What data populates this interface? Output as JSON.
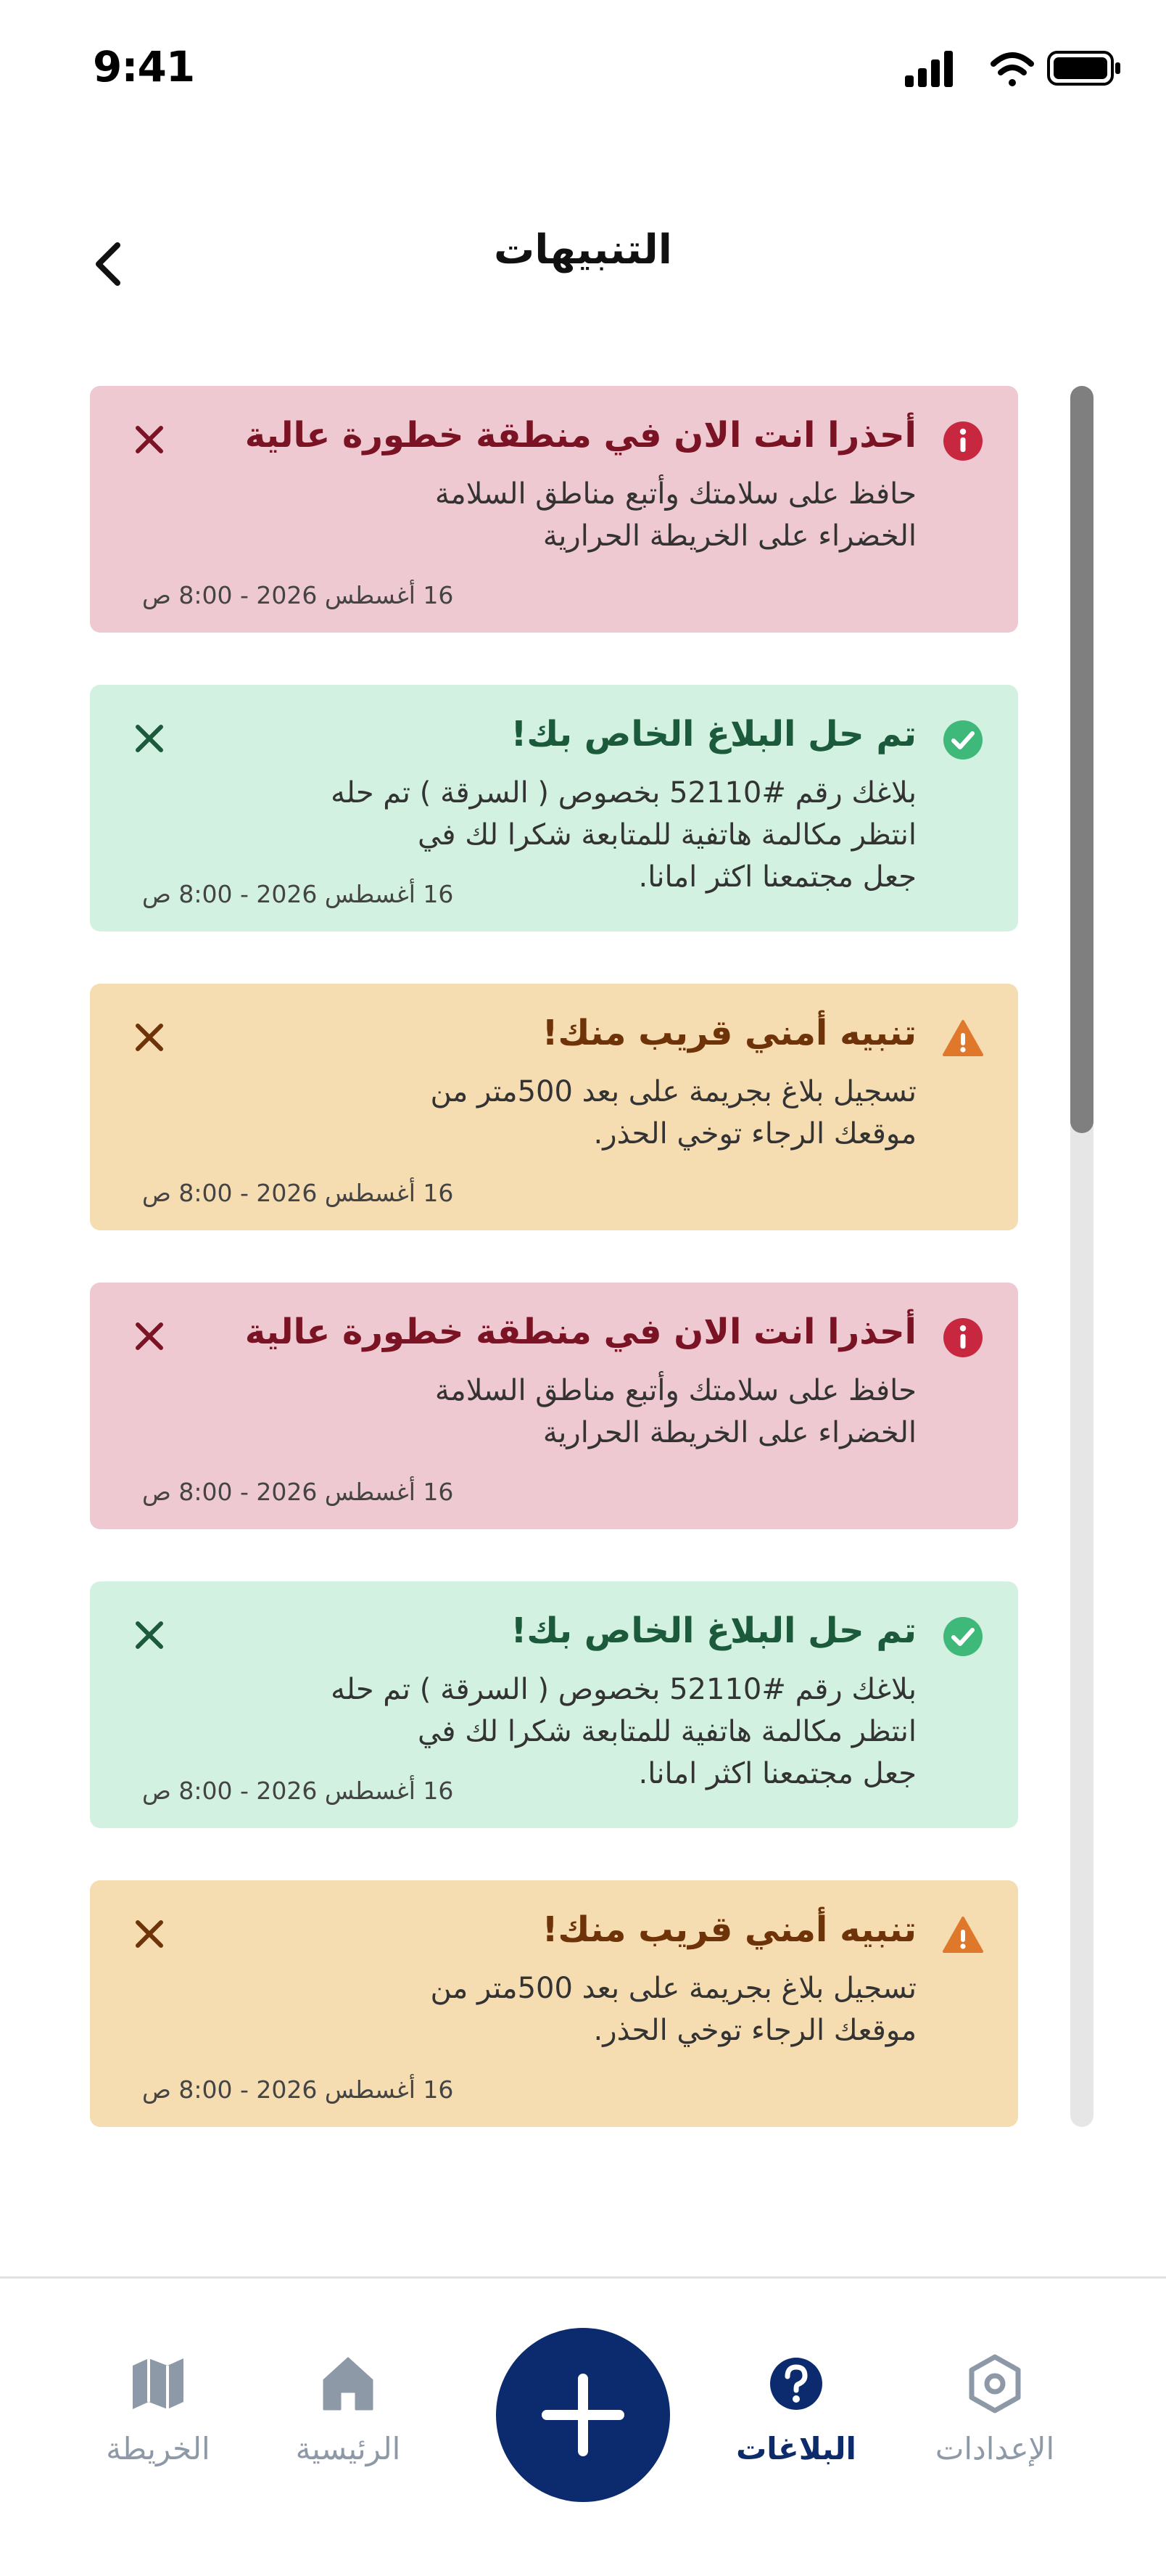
{
  "status_bar": {
    "time": "9:41"
  },
  "header": {
    "title": "التنبيهات"
  },
  "alerts": [
    {
      "type": "danger",
      "icon": "info-icon",
      "title": "أحذرا انت الان في منطقة خطورة عالية",
      "body": "حافظ على سلامتك وأتبع مناطق السلامة\nالخضراء على الخريطة الحرارية",
      "date": "16 أغسطس 2026 - 8:00 ص"
    },
    {
      "type": "success",
      "icon": "check-icon",
      "title": "تم حل البلاغ الخاص بك!",
      "body": "بلاغك رقم #52110 بخصوص ( السرقة ) تم حله\nانتظر مكالمة هاتفية للمتابعة شكرا لك في\nجعل مجتمعنا اكثر امانا.",
      "date": "16 أغسطس 2026 - 8:00 ص"
    },
    {
      "type": "warning",
      "icon": "warning-icon",
      "title": "تنبيه أمني قريب منك!",
      "body": "تسجيل بلاغ بجريمة على بعد 500متر من\nموقعك الرجاء توخي الحذر.",
      "date": "16 أغسطس 2026 - 8:00 ص"
    },
    {
      "type": "danger",
      "icon": "info-icon",
      "title": "أحذرا انت الان في منطقة خطورة عالية",
      "body": "حافظ على سلامتك وأتبع مناطق السلامة\nالخضراء على الخريطة الحرارية",
      "date": "16 أغسطس 2026 - 8:00 ص"
    },
    {
      "type": "success",
      "icon": "check-icon",
      "title": "تم حل البلاغ الخاص بك!",
      "body": "بلاغك رقم #52110 بخصوص ( السرقة ) تم حله\nانتظر مكالمة هاتفية للمتابعة شكرا لك في\nجعل مجتمعنا اكثر امانا.",
      "date": "16 أغسطس 2026 - 8:00 ص"
    },
    {
      "type": "warning",
      "icon": "warning-icon",
      "title": "تنبيه أمني قريب منك!",
      "body": "تسجيل بلاغ بجريمة على بعد 500متر من\nموقعك الرجاء توخي الحذر.",
      "date": "16 أغسطس 2026 - 8:00 ص"
    }
  ],
  "colors": {
    "danger_bg": "#efc9d1",
    "danger_icon": "#c8283f",
    "success_bg": "#d3f1e1",
    "success_icon": "#3fb979",
    "warning_bg": "#f6ddb1",
    "warning_icon": "#e0782c",
    "accent": "#0b2b6e"
  },
  "tabbar": {
    "items": [
      {
        "label": "الخريطة",
        "icon": "map-icon",
        "active": false
      },
      {
        "label": "الرئيسية",
        "icon": "home-icon",
        "active": false
      },
      {
        "label": "البلاغات",
        "icon": "question-icon",
        "active": true
      },
      {
        "label": "الإعدادات",
        "icon": "settings-icon",
        "active": false
      }
    ],
    "fab_icon": "plus-icon"
  }
}
